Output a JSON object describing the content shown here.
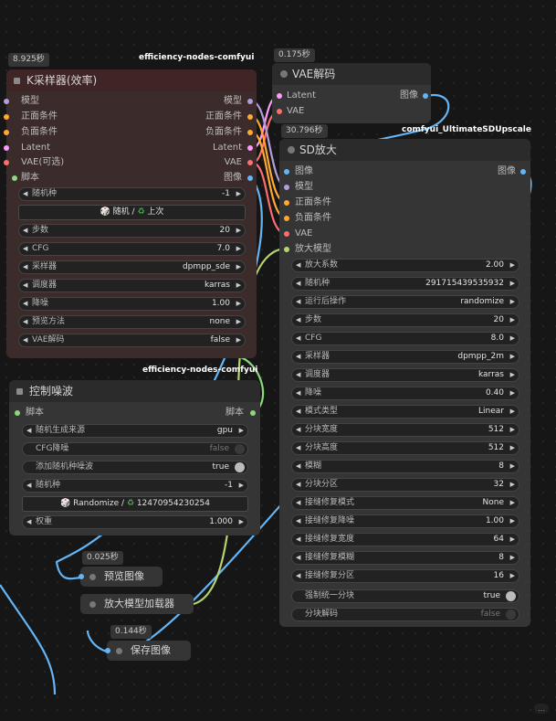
{
  "ksampler": {
    "time": "8.925秒",
    "source": "efficiency-nodes-comfyui",
    "title": "K采样器(效率)",
    "inputs": [
      "模型",
      "正面条件",
      "负面条件",
      "Latent",
      "VAE(可选)",
      "脚本"
    ],
    "outputs": [
      "模型",
      "正面条件",
      "负面条件",
      "Latent",
      "VAE",
      "图像"
    ],
    "seed": {
      "label": "随机种",
      "value": "-1"
    },
    "seed_button": {
      "a": "随机",
      "b": "上次"
    },
    "widgets": [
      {
        "label": "步数",
        "value": "20"
      },
      {
        "label": "CFG",
        "value": "7.0"
      },
      {
        "label": "采样器",
        "value": "dpmpp_sde"
      },
      {
        "label": "调度器",
        "value": "karras"
      },
      {
        "label": "降噪",
        "value": "1.00"
      },
      {
        "label": "预览方法",
        "value": "none"
      },
      {
        "label": "VAE解码",
        "value": "false"
      }
    ]
  },
  "vae": {
    "time": "0.175秒",
    "title": "VAE解码",
    "inputs": [
      "Latent",
      "VAE"
    ],
    "output": "图像"
  },
  "sdup": {
    "time": "30.796秒",
    "source": "comfyui_UltimateSDUpscale",
    "title": "SD放大",
    "inputs": [
      "图像",
      "模型",
      "正面条件",
      "负面条件",
      "VAE",
      "放大模型"
    ],
    "output": "图像",
    "widgets": [
      {
        "label": "放大系数",
        "value": "2.00"
      },
      {
        "label": "随机种",
        "value": "291715439535932"
      },
      {
        "label": "运行后操作",
        "value": "randomize"
      },
      {
        "label": "步数",
        "value": "20"
      },
      {
        "label": "CFG",
        "value": "8.0"
      },
      {
        "label": "采样器",
        "value": "dpmpp_2m"
      },
      {
        "label": "调度器",
        "value": "karras"
      },
      {
        "label": "降噪",
        "value": "0.40"
      },
      {
        "label": "模式类型",
        "value": "Linear"
      },
      {
        "label": "分块宽度",
        "value": "512"
      },
      {
        "label": "分块高度",
        "value": "512"
      },
      {
        "label": "模糊",
        "value": "8"
      },
      {
        "label": "分块分区",
        "value": "32"
      },
      {
        "label": "接缝修复模式",
        "value": "None"
      },
      {
        "label": "接缝修复降噪",
        "value": "1.00"
      },
      {
        "label": "接缝修复宽度",
        "value": "64"
      },
      {
        "label": "接缝修复模糊",
        "value": "8"
      },
      {
        "label": "接缝修复分区",
        "value": "16"
      }
    ],
    "toggles": [
      {
        "label": "强制统一分块",
        "value": "true",
        "on": true
      },
      {
        "label": "分块解码",
        "value": "false",
        "on": false
      }
    ]
  },
  "noise": {
    "source": "efficiency-nodes-comfyui",
    "title": "控制噪波",
    "input": "脚本",
    "output": "脚本",
    "widgets": [
      {
        "kind": "combo",
        "label": "随机生成来源",
        "value": "gpu"
      },
      {
        "kind": "toggle",
        "label": "CFG降噪",
        "value": "false",
        "on": false
      },
      {
        "kind": "toggle",
        "label": "添加随机种噪波",
        "value": "true",
        "on": true
      },
      {
        "kind": "combo",
        "label": "随机种",
        "value": "-1"
      }
    ],
    "seed_button": {
      "a": "Randomize /",
      "b": "12470954230254"
    },
    "weight": {
      "label": "权重",
      "value": "1.000"
    }
  },
  "preview": {
    "time": "0.025秒",
    "title": "预览图像"
  },
  "loader": {
    "title": "放大模型加载器"
  },
  "save": {
    "time": "0.144秒",
    "title": "保存图像"
  },
  "corner": "..."
}
